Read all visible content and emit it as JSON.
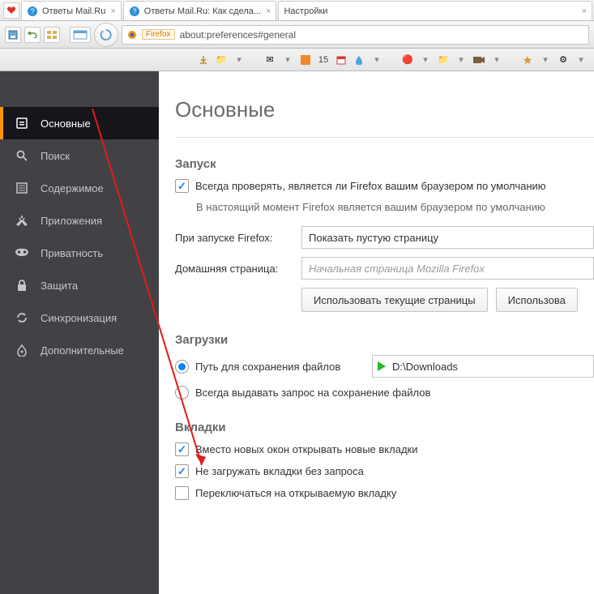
{
  "tabs": [
    {
      "label": "Ответы Mail.Ru"
    },
    {
      "label": "Ответы Mail.Ru: Как сдела..."
    },
    {
      "label": "Настройки",
      "active": true
    }
  ],
  "address": {
    "badge": "Firefox",
    "url": "about:preferences#general"
  },
  "bookmark_bar": {
    "number": "15"
  },
  "sidebar": {
    "items": [
      {
        "label": "Основные",
        "icon": "general-icon",
        "active": true
      },
      {
        "label": "Поиск",
        "icon": "search-icon"
      },
      {
        "label": "Содержимое",
        "icon": "content-icon"
      },
      {
        "label": "Приложения",
        "icon": "apps-icon"
      },
      {
        "label": "Приватность",
        "icon": "privacy-icon"
      },
      {
        "label": "Защита",
        "icon": "security-icon"
      },
      {
        "label": "Синхронизация",
        "icon": "sync-icon"
      },
      {
        "label": "Дополнительные",
        "icon": "advanced-icon"
      }
    ]
  },
  "page": {
    "title": "Основные",
    "startup": {
      "heading": "Запуск",
      "check_default_label": "Всегда проверять, является ли Firefox вашим браузером по умолчанию",
      "status_note": "В настоящий момент Firefox является вашим браузером по умолчанию",
      "on_launch_label": "При запуске Firefox:",
      "on_launch_value": "Показать пустую страницу",
      "homepage_label": "Домашняя страница:",
      "homepage_placeholder": "Начальная страница Mozilla Firefox",
      "btn_use_current": "Использовать текущие страницы",
      "btn_use_bookmark": "Использова"
    },
    "downloads": {
      "heading": "Загрузки",
      "save_to_label": "Путь для сохранения файлов",
      "save_to_value": "D:\\Downloads",
      "ask_label": "Всегда выдавать запрос на сохранение файлов"
    },
    "tabs_sect": {
      "heading": "Вкладки",
      "open_new_tabs": "Вместо новых окон открывать новые вкладки",
      "dont_load": "Не загружать вкладки без запроса",
      "switch_to": "Переключаться на открываемую вкладку"
    }
  }
}
